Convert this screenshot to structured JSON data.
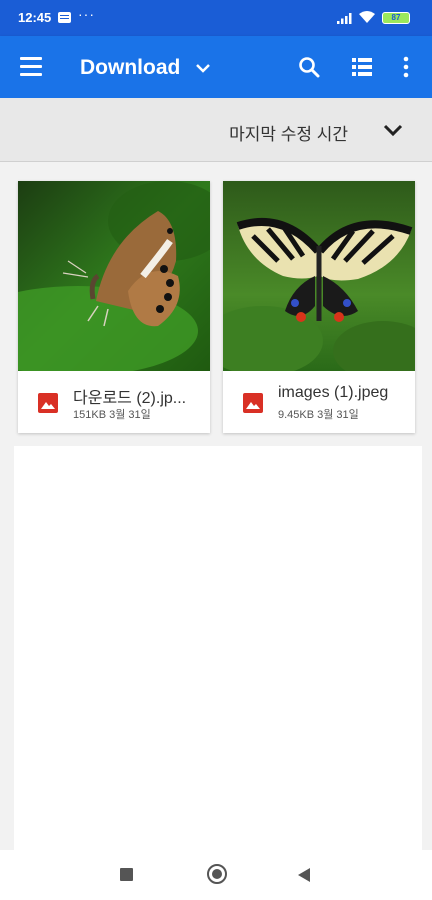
{
  "status_bar": {
    "time": "12:45",
    "dots": "···",
    "battery": "87"
  },
  "app_bar": {
    "title": "Download"
  },
  "sort": {
    "label": "마지막 수정 시간"
  },
  "files": [
    {
      "name": "다운로드 (2).jp...",
      "meta": "151KB 3월 31일"
    },
    {
      "name": "images (1).jpeg",
      "meta": "9.45KB 3월 31일"
    }
  ],
  "colors": {
    "status_bar": "#1a5dd6",
    "app_bar": "#1a73e8",
    "image_icon": "#d93025"
  }
}
